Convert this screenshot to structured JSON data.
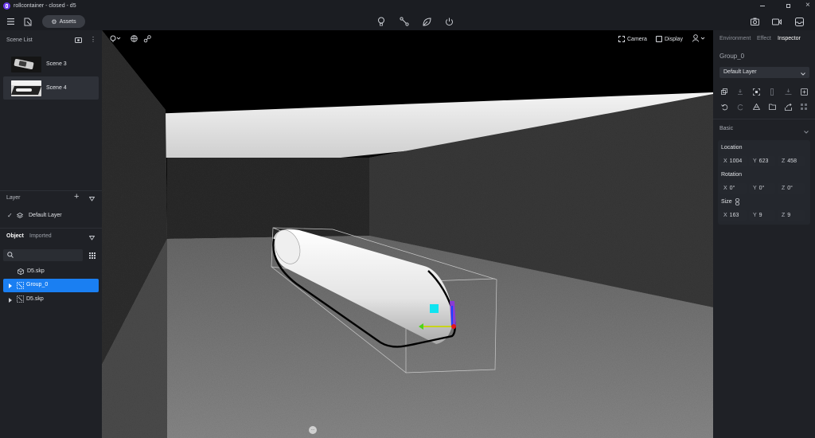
{
  "window": {
    "title": "rollcontainer - closed - d5",
    "controls": [
      "minimize",
      "restore",
      "close"
    ]
  },
  "toolbar": {
    "assets_label": "Assets",
    "center_tools": [
      "lightbulb-icon",
      "path-icon",
      "leaf-icon",
      "power-icon"
    ],
    "right_tools": [
      "camera-icon",
      "video-icon",
      "inbox-icon"
    ]
  },
  "scene_list": {
    "title": "Scene List",
    "items": [
      {
        "label": "Scene 3",
        "selected": false
      },
      {
        "label": "Scene 4",
        "selected": true
      }
    ]
  },
  "layer_panel": {
    "title": "Layer",
    "items": [
      {
        "label": "Default Layer",
        "checked": true
      }
    ]
  },
  "object_panel": {
    "tabs": [
      {
        "label": "Object",
        "active": true
      },
      {
        "label": "Imported",
        "active": false
      }
    ],
    "search_placeholder": "",
    "items": [
      {
        "label": "D5.skp",
        "expandable": false,
        "selected": false
      },
      {
        "label": "Group_0",
        "expandable": true,
        "selected": true
      },
      {
        "label": "D5.skp",
        "expandable": true,
        "selected": false
      }
    ]
  },
  "viewport": {
    "camera_label": "Camera",
    "display_label": "Display"
  },
  "inspector": {
    "tabs": [
      {
        "label": "Environment",
        "active": false
      },
      {
        "label": "Effect",
        "active": false
      },
      {
        "label": "Inspector",
        "active": true
      }
    ],
    "object_name": "Group_0",
    "layer_select": "Default Layer",
    "basic_label": "Basic",
    "location_label": "Location",
    "location": {
      "x": "1004",
      "y": "623",
      "z": "458"
    },
    "rotation_label": "Rotation",
    "rotation": {
      "x": "0°",
      "y": "0°",
      "z": "0°"
    },
    "size_label": "Size",
    "size": {
      "x": "163",
      "y": "9",
      "z": "9"
    },
    "axis_labels": {
      "x": "X",
      "y": "Y",
      "z": "Z"
    }
  },
  "colors": {
    "accent": "#1a7ff2",
    "panel": "#1f2126",
    "background": "#1b1d22",
    "field": "#25282e"
  }
}
